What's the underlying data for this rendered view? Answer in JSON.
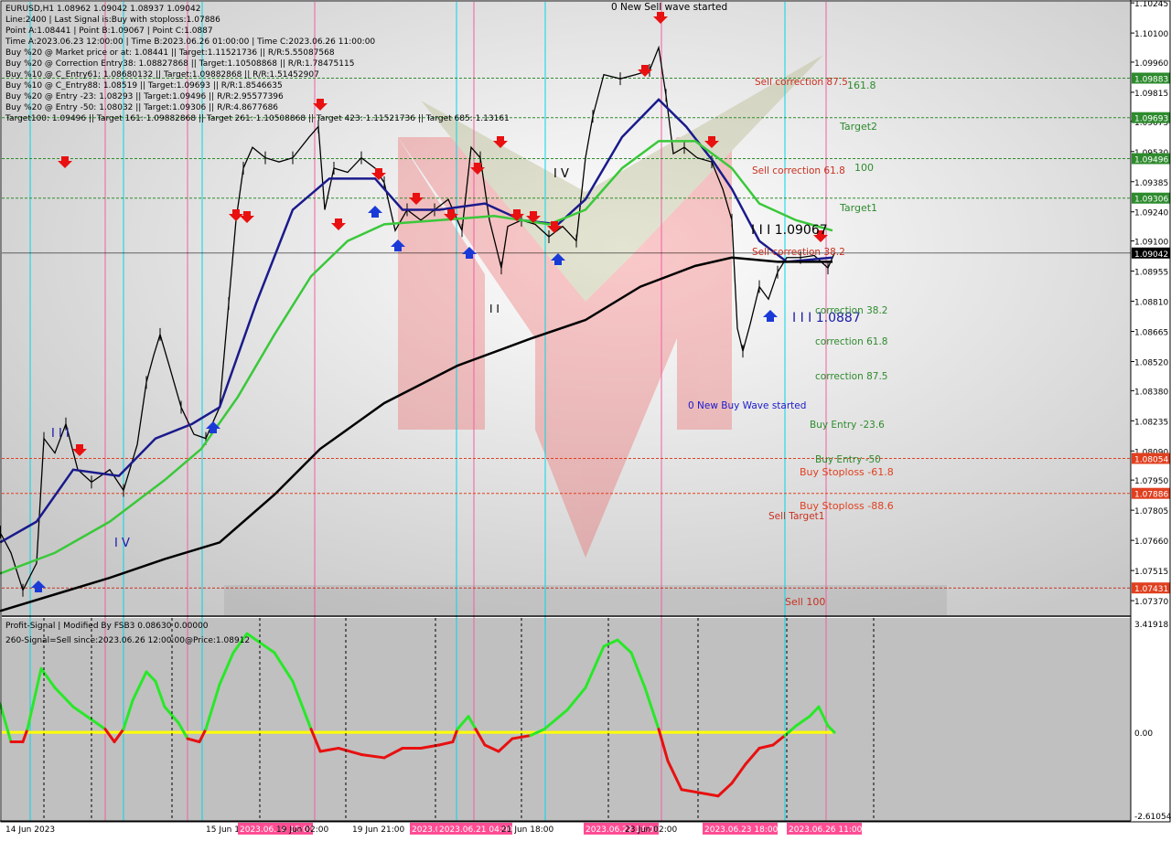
{
  "info": {
    "lines": [
      "EURUSD,H1  1.08962 1.09042 1.08937 1.09042",
      "Line:2400 | Last Signal is:Buy with stoploss:1.07886",
      "Point A:1.08441 | Point B:1.09067 | Point C:1.0887",
      "Time A:2023.06.23 12:00:00 | Time B:2023.06.26 01:00:00 | Time C:2023.06.26 11:00:00",
      "Buy %20 @ Market price or at: 1.08441 || Target:1.11521736 || R/R:5.55087568",
      "Buy %20 @ Correction Entry38: 1.08827868 || Target:1.10508868 || R/R:1.78475115",
      "Buy %10 @ C_Entry61: 1.08680132 || Target:1.09882868 || R/R:1.51452907",
      "Buy %10 @ C_Entry88: 1.08519 || Target:1.09693 || R/R:1.8546635",
      "Buy %20 @ Entry -23: 1.08293 || Target:1.09496 || R/R:2.95577396",
      "Buy %20 @ Entry -50: 1.08032 || Target:1.09306 || R/R:4.8677686",
      "Target100: 1.09496 || Target 161: 1.09882868 || Target 261: 1.10508868 || Target 423: 1.11521736 || Target 685: 1.13161"
    ]
  },
  "oscillator": {
    "line1": "Profit-Signal | Modified By FSB3 0.08630 0.00000",
    "line2": "260-Signal=Sell since:2023.06.26 12:00:00@Price:1.08912"
  },
  "chart_data": {
    "type": "line",
    "symbol": "EURUSD,H1",
    "ylim": [
      1.073,
      1.1025
    ],
    "y_ticks": [
      "1.10245",
      "1.10100",
      "1.09960",
      "1.09815",
      "1.09675",
      "1.09530",
      "1.09385",
      "1.09240",
      "1.09100",
      "1.08955",
      "1.08810",
      "1.08665",
      "1.08520",
      "1.08380",
      "1.08235",
      "1.08090",
      "1.07950",
      "1.07805",
      "1.07660",
      "1.07515",
      "1.07370"
    ],
    "x_labels": [
      "14 Jun 2023",
      "15 Jun 18:00",
      "2023.06.16 15:00",
      "19 Jun 02:00",
      "19 Jun 21:00",
      "2023.06.20 11:00",
      "2023.06.21 04:00",
      "21 Jun 18:00",
      "2023.06.22 14:00",
      "23 Jun 02:00",
      "2023.06.23 18:00",
      "2023.06.26 11:00"
    ],
    "price_levels": [
      {
        "price": 1.09883,
        "label": "1.09883",
        "text": "161.8",
        "color": "#2e8b2e"
      },
      {
        "price": 1.09693,
        "label": "1.09693",
        "text": "Target2",
        "color": "#2e8b2e"
      },
      {
        "price": 1.09496,
        "label": "1.09496",
        "text": "100",
        "color": "#2e8b2e"
      },
      {
        "price": 1.09306,
        "label": "1.09306",
        "text": "Target1",
        "color": "#2e8b2e"
      },
      {
        "price": 1.09042,
        "label": "1.09042",
        "text": "",
        "color": "#000000"
      },
      {
        "price": 1.08054,
        "label": "1.08054",
        "text": "Buy Stoploss -61.8",
        "color": "#e04020"
      },
      {
        "price": 1.07886,
        "label": "1.07886",
        "text": "Buy Stoploss -88.6",
        "color": "#e04020"
      },
      {
        "price": 1.07431,
        "label": "1.07431",
        "text": "Sell 100",
        "color": "#c83020"
      }
    ],
    "annotations": [
      {
        "text": "0 New Sell wave started",
        "color": "#000000"
      },
      {
        "text": "Sell correction 87.5",
        "color": "#c83020"
      },
      {
        "text": "Sell correction 61.8",
        "color": "#c83020"
      },
      {
        "text": "Sell correction 38.2",
        "color": "#c83020"
      },
      {
        "text": "I I I 1.09067",
        "color": "#000000"
      },
      {
        "text": "I I I 1.0887",
        "color": "#1a1aa8"
      },
      {
        "text": "correction 38.2",
        "color": "#2e8b2e"
      },
      {
        "text": "correction 61.8",
        "color": "#2e8b2e"
      },
      {
        "text": "correction 87.5",
        "color": "#2e8b2e"
      },
      {
        "text": "0 New Buy Wave started",
        "color": "#1a1acc"
      },
      {
        "text": "Buy Entry -23.6",
        "color": "#2e8b2e"
      },
      {
        "text": "Buy Entry -50",
        "color": "#2e8b2e"
      },
      {
        "text": "Sell Target1",
        "color": "#c83020"
      }
    ],
    "price_path": [
      [
        0,
        1.077
      ],
      [
        12,
        1.076
      ],
      [
        25,
        1.0742
      ],
      [
        40,
        1.0755
      ],
      [
        48,
        1.0815
      ],
      [
        60,
        1.0808
      ],
      [
        72,
        1.0822
      ],
      [
        85,
        1.08
      ],
      [
        100,
        1.0794
      ],
      [
        120,
        1.08
      ],
      [
        135,
        1.079
      ],
      [
        150,
        1.0812
      ],
      [
        160,
        1.0842
      ],
      [
        168,
        1.0855
      ],
      [
        175,
        1.0865
      ],
      [
        185,
        1.085
      ],
      [
        198,
        1.083
      ],
      [
        212,
        1.0817
      ],
      [
        225,
        1.0815
      ],
      [
        240,
        1.083
      ],
      [
        250,
        1.088
      ],
      [
        258,
        1.092
      ],
      [
        266,
        1.0945
      ],
      [
        276,
        1.0955
      ],
      [
        290,
        1.095
      ],
      [
        305,
        1.0948
      ],
      [
        320,
        1.095
      ],
      [
        338,
        1.096
      ],
      [
        348,
        1.0965
      ],
      [
        355,
        1.0925
      ],
      [
        365,
        1.0945
      ],
      [
        380,
        1.0943
      ],
      [
        395,
        1.095
      ],
      [
        410,
        1.0945
      ],
      [
        420,
        1.0938
      ],
      [
        432,
        1.0915
      ],
      [
        445,
        1.0925
      ],
      [
        460,
        1.092
      ],
      [
        475,
        1.0925
      ],
      [
        490,
        1.093
      ],
      [
        505,
        1.0915
      ],
      [
        515,
        1.0955
      ],
      [
        525,
        1.095
      ],
      [
        535,
        1.092
      ],
      [
        548,
        1.0897
      ],
      [
        555,
        1.0917
      ],
      [
        570,
        1.092
      ],
      [
        585,
        1.0918
      ],
      [
        600,
        1.0912
      ],
      [
        615,
        1.0917
      ],
      [
        630,
        1.091
      ],
      [
        640,
        1.095
      ],
      [
        648,
        1.097
      ],
      [
        660,
        1.099
      ],
      [
        678,
        1.0988
      ],
      [
        695,
        1.099
      ],
      [
        710,
        1.0992
      ],
      [
        720,
        1.1003
      ],
      [
        728,
        1.098
      ],
      [
        736,
        1.0952
      ],
      [
        748,
        1.0955
      ],
      [
        762,
        1.095
      ],
      [
        778,
        1.0948
      ],
      [
        790,
        1.0935
      ],
      [
        800,
        1.092
      ],
      [
        806,
        1.0868
      ],
      [
        812,
        1.0857
      ],
      [
        820,
        1.087
      ],
      [
        830,
        1.0888
      ],
      [
        840,
        1.0882
      ],
      [
        850,
        1.0895
      ],
      [
        860,
        1.0902
      ],
      [
        875,
        1.0902
      ],
      [
        890,
        1.0903
      ],
      [
        905,
        1.0897
      ],
      [
        912,
        1.0904
      ]
    ],
    "series": [
      {
        "name": "",
        "color": "#1a1a8c",
        "values": [
          [
            0,
            1.0765
          ],
          [
            40,
            1.0775
          ],
          [
            80,
            1.08
          ],
          [
            130,
            1.0797
          ],
          [
            170,
            1.0815
          ],
          [
            210,
            1.0822
          ],
          [
            240,
            1.083
          ],
          [
            280,
            1.088
          ],
          [
            320,
            1.0925
          ],
          [
            360,
            1.094
          ],
          [
            410,
            1.094
          ],
          [
            440,
            1.0925
          ],
          [
            480,
            1.0925
          ],
          [
            530,
            1.0928
          ],
          [
            570,
            1.092
          ],
          [
            610,
            1.0918
          ],
          [
            640,
            1.093
          ],
          [
            680,
            1.096
          ],
          [
            720,
            1.0978
          ],
          [
            750,
            1.0965
          ],
          [
            780,
            1.0948
          ],
          [
            800,
            1.0935
          ],
          [
            830,
            1.091
          ],
          [
            860,
            1.09
          ],
          [
            910,
            1.0902
          ]
        ]
      },
      {
        "name": "",
        "color": "#3ac83a",
        "values": [
          [
            0,
            1.075
          ],
          [
            60,
            1.076
          ],
          [
            120,
            1.0775
          ],
          [
            180,
            1.0795
          ],
          [
            220,
            1.081
          ],
          [
            260,
            1.0835
          ],
          [
            300,
            1.0865
          ],
          [
            340,
            1.0893
          ],
          [
            380,
            1.091
          ],
          [
            420,
            1.0918
          ],
          [
            480,
            1.092
          ],
          [
            540,
            1.0922
          ],
          [
            600,
            1.0918
          ],
          [
            640,
            1.0925
          ],
          [
            680,
            1.0945
          ],
          [
            720,
            1.0958
          ],
          [
            760,
            1.0958
          ],
          [
            800,
            1.0945
          ],
          [
            830,
            1.0928
          ],
          [
            870,
            1.092
          ],
          [
            910,
            1.0915
          ]
        ]
      },
      {
        "name": "",
        "color": "#000000",
        "values": [
          [
            0,
            1.0732
          ],
          [
            60,
            1.074
          ],
          [
            120,
            1.0748
          ],
          [
            180,
            1.0757
          ],
          [
            240,
            1.0765
          ],
          [
            300,
            1.0788
          ],
          [
            350,
            1.081
          ],
          [
            420,
            1.0832
          ],
          [
            500,
            1.085
          ],
          [
            580,
            1.0863
          ],
          [
            640,
            1.0872
          ],
          [
            700,
            1.0888
          ],
          [
            760,
            1.0898
          ],
          [
            800,
            1.0902
          ],
          [
            850,
            1.09
          ],
          [
            910,
            1.09
          ]
        ]
      }
    ],
    "oscillator": {
      "ylim": [
        -2.61054,
        3.41918
      ],
      "y_ticks": [
        "3.41918",
        "0.00",
        "-2.61054"
      ],
      "signal_line": 0.0,
      "values": [
        [
          0,
          0.9
        ],
        [
          12,
          -0.3
        ],
        [
          25,
          -0.3
        ],
        [
          30,
          0.1
        ],
        [
          45,
          2.0
        ],
        [
          60,
          1.4
        ],
        [
          80,
          0.8
        ],
        [
          100,
          0.4
        ],
        [
          115,
          0.1
        ],
        [
          125,
          -0.3
        ],
        [
          135,
          0.1
        ],
        [
          145,
          1.0
        ],
        [
          160,
          1.9
        ],
        [
          170,
          1.6
        ],
        [
          180,
          0.8
        ],
        [
          195,
          0.3
        ],
        [
          205,
          -0.2
        ],
        [
          218,
          -0.3
        ],
        [
          225,
          0.1
        ],
        [
          240,
          1.5
        ],
        [
          255,
          2.5
        ],
        [
          270,
          3.1
        ],
        [
          285,
          2.8
        ],
        [
          300,
          2.5
        ],
        [
          320,
          1.6
        ],
        [
          340,
          0.1
        ],
        [
          350,
          -0.6
        ],
        [
          370,
          -0.5
        ],
        [
          395,
          -0.7
        ],
        [
          420,
          -0.8
        ],
        [
          440,
          -0.5
        ],
        [
          460,
          -0.5
        ],
        [
          480,
          -0.4
        ],
        [
          495,
          -0.3
        ],
        [
          500,
          0.1
        ],
        [
          512,
          0.5
        ],
        [
          520,
          0.1
        ],
        [
          530,
          -0.4
        ],
        [
          545,
          -0.6
        ],
        [
          560,
          -0.2
        ],
        [
          580,
          -0.1
        ],
        [
          595,
          0.1
        ],
        [
          620,
          0.7
        ],
        [
          640,
          1.4
        ],
        [
          660,
          2.7
        ],
        [
          675,
          2.9
        ],
        [
          690,
          2.5
        ],
        [
          705,
          1.4
        ],
        [
          720,
          0.1
        ],
        [
          730,
          -0.9
        ],
        [
          745,
          -1.8
        ],
        [
          765,
          -1.9
        ],
        [
          785,
          -2.0
        ],
        [
          800,
          -1.6
        ],
        [
          815,
          -1.0
        ],
        [
          830,
          -0.5
        ],
        [
          845,
          -0.4
        ],
        [
          858,
          -0.1
        ],
        [
          870,
          0.2
        ],
        [
          885,
          0.5
        ],
        [
          895,
          0.8
        ],
        [
          905,
          0.2
        ],
        [
          912,
          0.0
        ]
      ]
    },
    "grid": false,
    "legend": "none"
  },
  "colors": {
    "cyan_line": "#00d8e8",
    "magenta_line": "#f060a0",
    "buy_arrow": "#1a3ad8",
    "sell_arrow": "#e81010",
    "signal_yellow": "#ffff00",
    "osc_up": "#28e828",
    "osc_down": "#e81010"
  }
}
